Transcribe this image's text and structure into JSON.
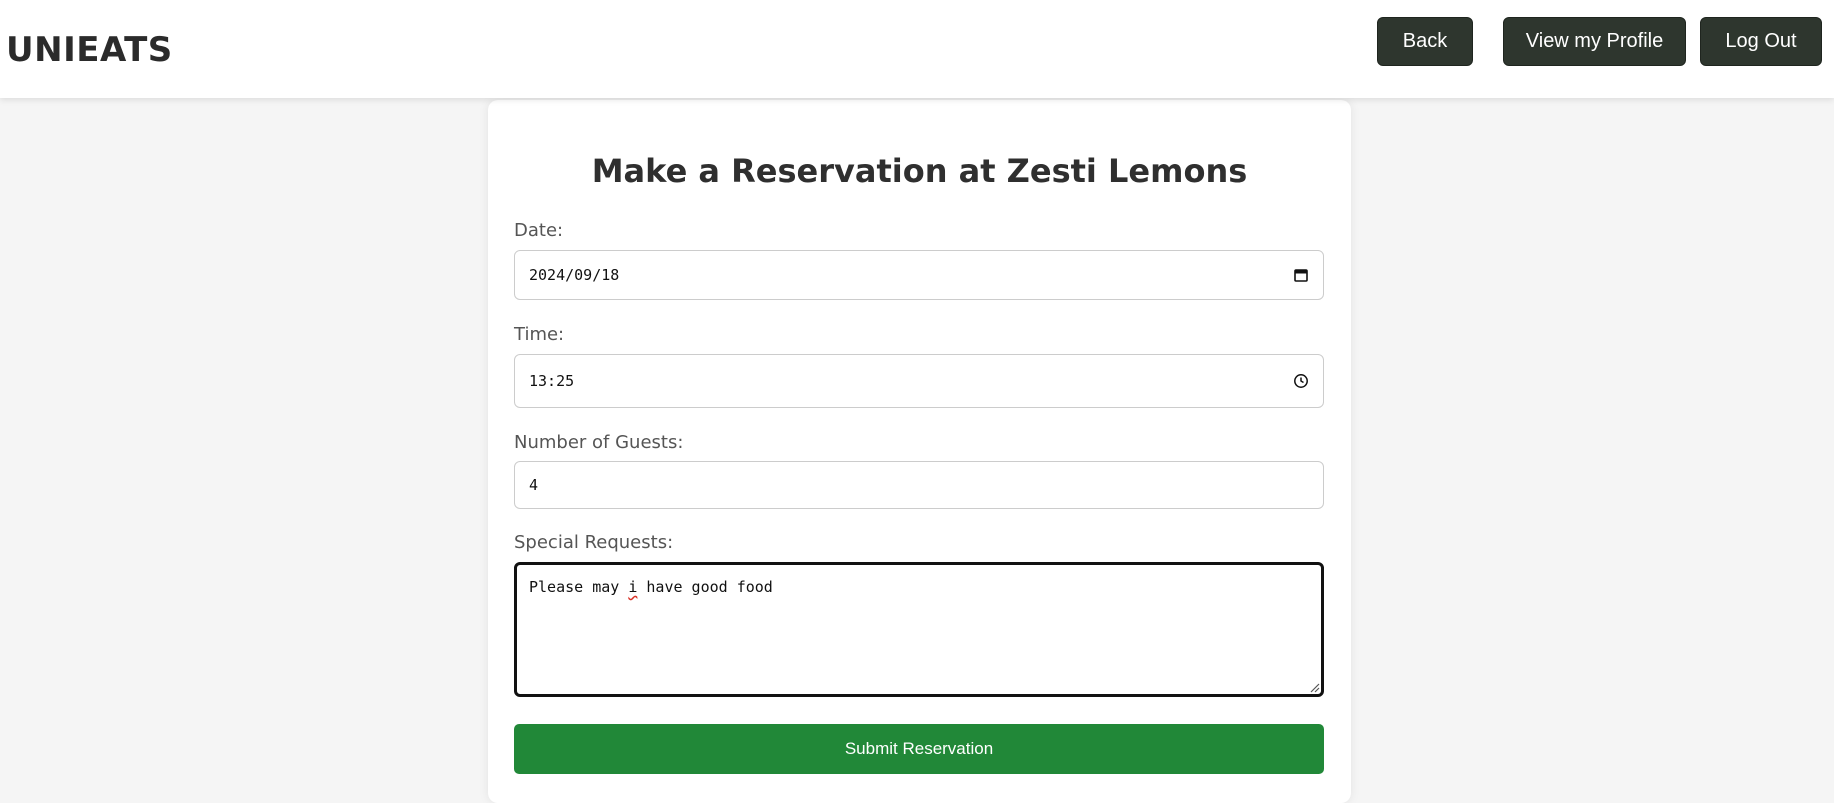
{
  "header": {
    "brand": "UNIEATS",
    "back_label": "Back",
    "profile_label": "View my Profile",
    "logout_label": "Log Out"
  },
  "reservation": {
    "title": "Make a Reservation at Zesti Lemons",
    "date_label": "Date:",
    "date_value": "2024/09/18",
    "time_label": "Time:",
    "time_value": "13:25",
    "guests_label": "Number of Guests:",
    "guests_value": "4",
    "requests_label": "Special Requests:",
    "requests_before": "Please may ",
    "requests_flagged_word": "i",
    "requests_after": " have good food",
    "submit_label": "Submit Reservation"
  },
  "icons": {
    "date": "calendar-icon",
    "time": "clock-icon"
  },
  "colors": {
    "nav_button": "#2e362e",
    "submit_button": "#218838",
    "page_background": "#f5f5f5"
  }
}
